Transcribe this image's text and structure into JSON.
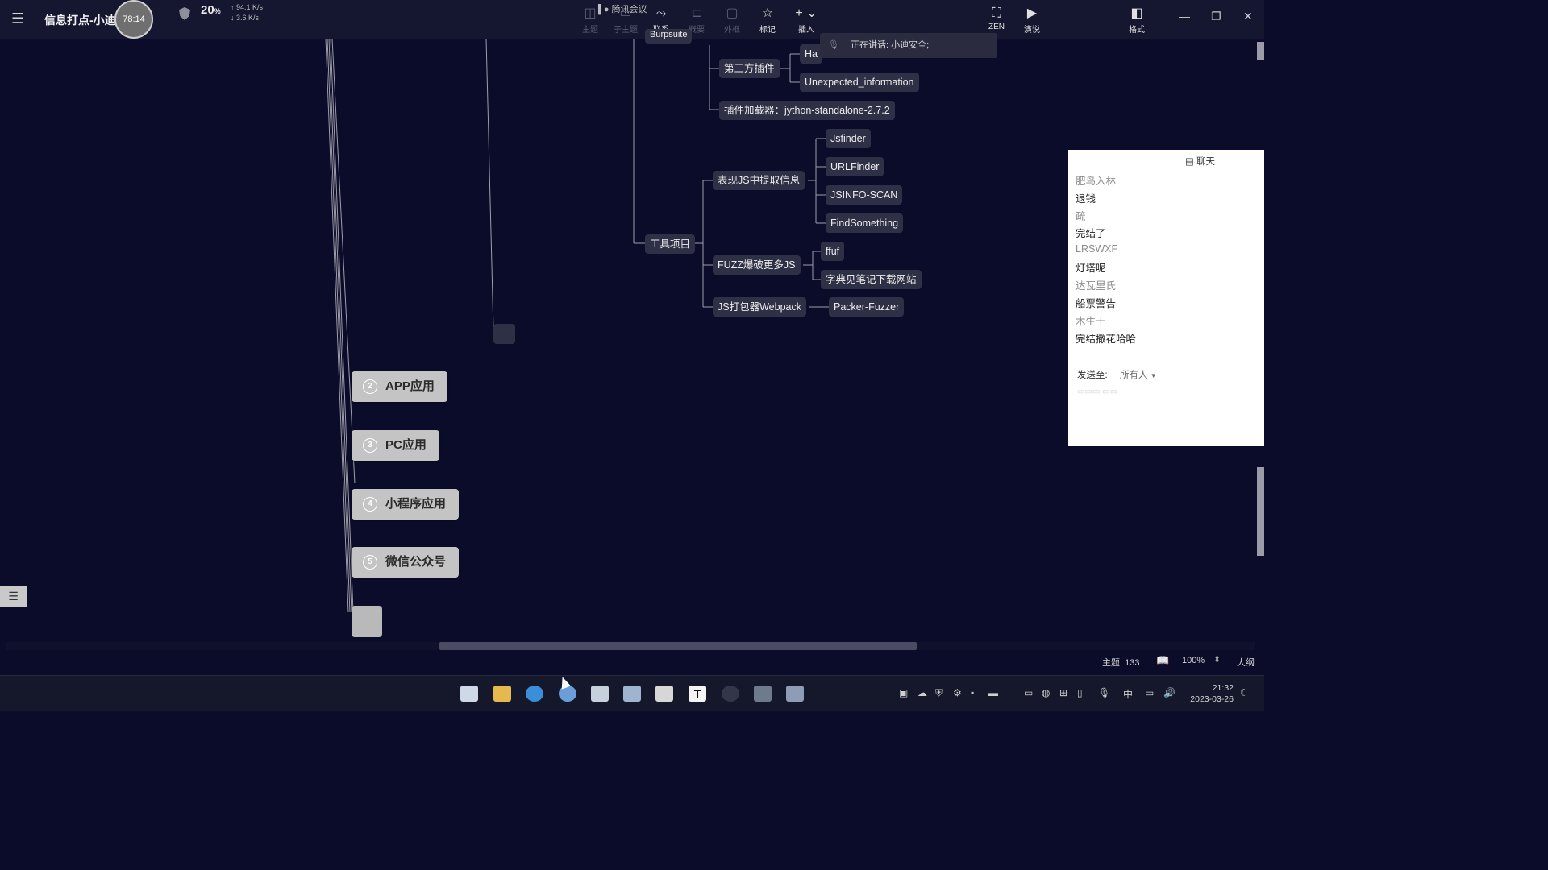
{
  "app": {
    "title": "信息打点-小迪",
    "timer": "78:14",
    "cpu_value": "20",
    "cpu_unit": "%",
    "net_up": "↑ 94.1 K/s",
    "net_down": "↓ 3.6 K/s",
    "meeting_label": "腾讯会议"
  },
  "toolbar": {
    "items": [
      {
        "label": "主题",
        "icon": "theme-icon",
        "glyph": "◫",
        "enabled": false
      },
      {
        "label": "子主题",
        "icon": "subtopic-icon",
        "glyph": "▭",
        "enabled": false
      },
      {
        "label": "联系",
        "icon": "relationship-icon",
        "glyph": "⤳",
        "enabled": true
      },
      {
        "label": "概要",
        "icon": "summary-icon",
        "glyph": "⊏",
        "enabled": false
      },
      {
        "label": "外框",
        "icon": "boundary-icon",
        "glyph": "▢",
        "enabled": false
      },
      {
        "label": "标记",
        "icon": "star-icon",
        "glyph": "☆",
        "enabled": true
      },
      {
        "label": "插入",
        "icon": "plus-icon",
        "glyph": "+ ⌄",
        "enabled": true
      },
      {
        "label": "ZEN",
        "icon": "fullscreen-icon",
        "glyph": "⛶",
        "enabled": true
      },
      {
        "label": "演说",
        "icon": "present-icon",
        "glyph": "▶",
        "enabled": true
      },
      {
        "label": "格式",
        "icon": "format-panel-icon",
        "glyph": "◧",
        "enabled": true
      }
    ]
  },
  "speaking": {
    "text": "正在讲话: 小迪安全;"
  },
  "mindmap": {
    "partial_top_node": "Burpsuite",
    "nodes": {
      "third_party": "第三方插件",
      "ha": "Ha",
      "unexpected": "Unexpected_information",
      "plugin_loader": "插件加载器：jython-standalone-2.7.2",
      "js_extract": "表现JS中提取信息",
      "jsfinder": "Jsfinder",
      "urlfinder": "URLFinder",
      "jsinfo": "JSINFO-SCAN",
      "findsomething": "FindSomething",
      "tools": "工具项目",
      "fuzz": "FUZZ爆破更多JS",
      "ffuf": "ffuf",
      "dict": "字典见笔记下载网站",
      "webpack": "JS打包器Webpack",
      "packer": "Packer-Fuzzer"
    },
    "branches": [
      {
        "num": "2",
        "label": "APP应用"
      },
      {
        "num": "3",
        "label": "PC应用"
      },
      {
        "num": "4",
        "label": "小程序应用"
      },
      {
        "num": "5",
        "label": "微信公众号"
      }
    ]
  },
  "chat": {
    "title": "聊天",
    "messages": [
      {
        "name": "肥鸟入林",
        "text": "退钱"
      },
      {
        "name": "疏",
        "text": "完结了"
      },
      {
        "name": "LRSWXF",
        "text": "灯塔呢"
      },
      {
        "name": "达瓦里氏",
        "text": "船票警告"
      },
      {
        "name": "木生于",
        "text": "完结撒花哈哈"
      }
    ],
    "send_to_label": "发送至:",
    "send_to_value": "所有人"
  },
  "status": {
    "topics": "主题: 133",
    "zoom": "100%",
    "outline": "大纲"
  },
  "taskbar": {
    "input_method": "中",
    "time": "21:32",
    "date": "2023-03-26"
  },
  "colors": {
    "canvas": "#0b0c2a",
    "node": "#2e3045",
    "branch": "#c4c4c4"
  }
}
